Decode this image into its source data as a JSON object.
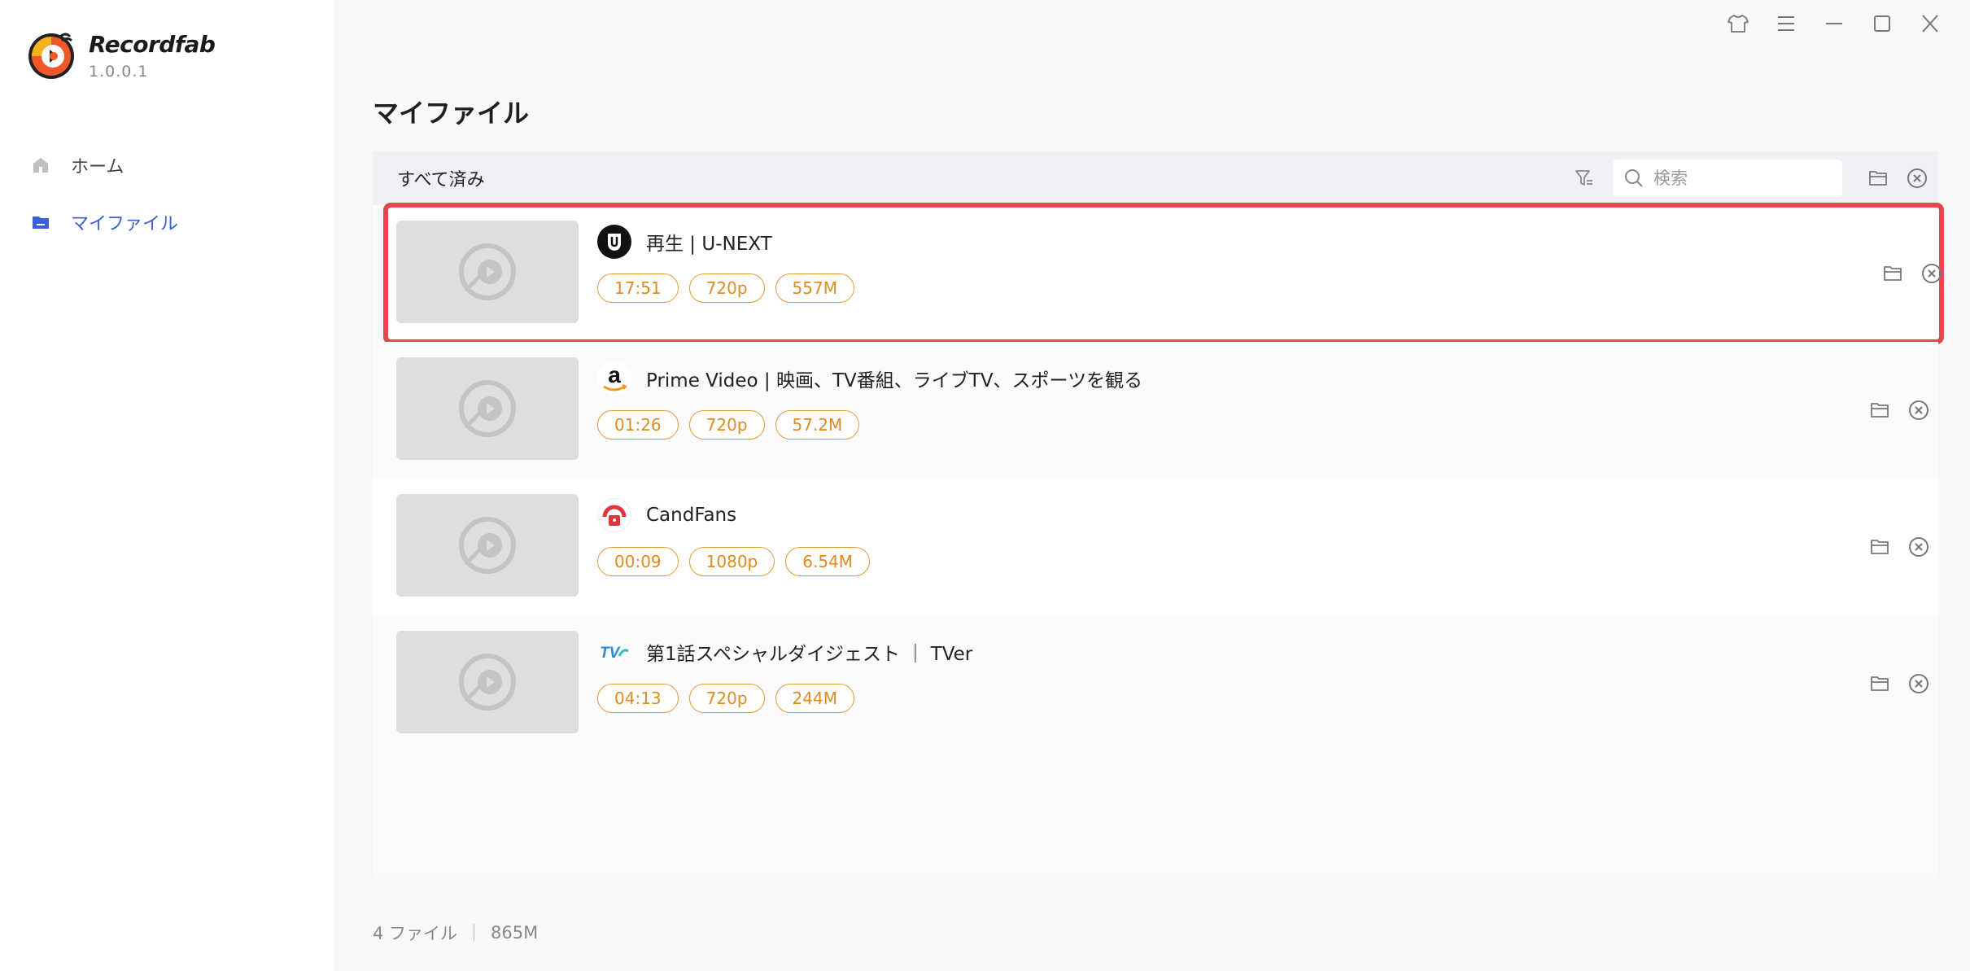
{
  "app": {
    "name": "Recordfab",
    "version": "1.0.0.1",
    "brand_colors": {
      "ring": "#f0582a",
      "accent": "#f6b21c",
      "dark": "#222222"
    }
  },
  "sidebar": {
    "items": [
      {
        "label": "ホーム",
        "icon": "home-icon",
        "active": false
      },
      {
        "label": "マイファイル",
        "icon": "folder-icon",
        "active": true
      }
    ],
    "active_color": "#3c5fd6"
  },
  "window_controls": [
    "shirt-skin-icon",
    "menu-icon",
    "minimize-icon",
    "maximize-icon",
    "close-icon"
  ],
  "main": {
    "title": "マイファイル",
    "filter_label": "すべて済み",
    "search": {
      "placeholder": "検索",
      "value": ""
    },
    "files": [
      {
        "title": "再生 | U-NEXT",
        "site": "U-NEXT",
        "site_icon": "unext-logo-icon",
        "duration": "17:51",
        "resolution": "720p",
        "size": "557M",
        "selected": true
      },
      {
        "title": "Prime Video | 映画、TV番組、ライブTV、スポーツを観る",
        "site": "Amazon",
        "site_icon": "amazon-logo-icon",
        "duration": "01:26",
        "resolution": "720p",
        "size": "57.2M",
        "selected": false
      },
      {
        "title": "CandFans",
        "site": "CandFans",
        "site_icon": "candfans-logo-icon",
        "duration": "00:09",
        "resolution": "1080p",
        "size": "6.54M",
        "selected": false
      },
      {
        "title": "第1話スペシャルダイジェスト ｜ TVer",
        "site": "TVer",
        "site_icon": "tver-logo-icon",
        "duration": "04:13",
        "resolution": "720p",
        "size": "244M",
        "selected": false
      }
    ],
    "tag_color": "#e08a1f",
    "selection_color": "#e4474c"
  },
  "footer": {
    "count": "4 ファイル",
    "total_size": "865M"
  }
}
